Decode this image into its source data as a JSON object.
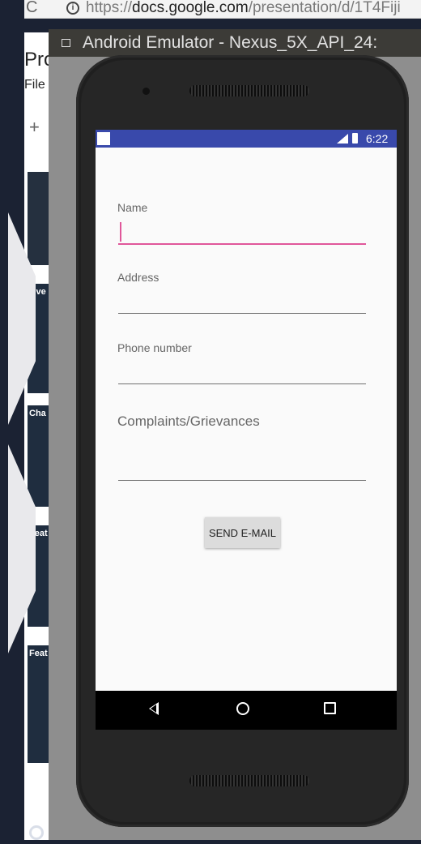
{
  "browser": {
    "url_prefix": "https://",
    "url_host": "docs.google.com",
    "url_path": "/presentation/d/1T4Fiji",
    "doc_title_partial": "Pro",
    "menu_partial": "File",
    "add_symbol": "+",
    "thumbnails": [
      "Ove",
      "Cha",
      "Feat",
      "Feat"
    ]
  },
  "emulator": {
    "window_title": "Android Emulator - Nexus_5X_API_24:"
  },
  "phone": {
    "statusbar": {
      "time": "6:22",
      "color": "#3949ab"
    },
    "form": {
      "name_label": "Name",
      "name_value": "",
      "address_label": "Address",
      "address_value": "",
      "phone_label": "Phone number",
      "phone_value": "",
      "complaints_label": "Complaints/Grievances",
      "complaints_value": "",
      "send_button": "SEND E-MAIL"
    },
    "navbar": {
      "back_icon": "back-triangle-icon",
      "home_icon": "home-circle-icon",
      "recents_icon": "recents-square-icon"
    },
    "accent_color": "#e0579a"
  }
}
